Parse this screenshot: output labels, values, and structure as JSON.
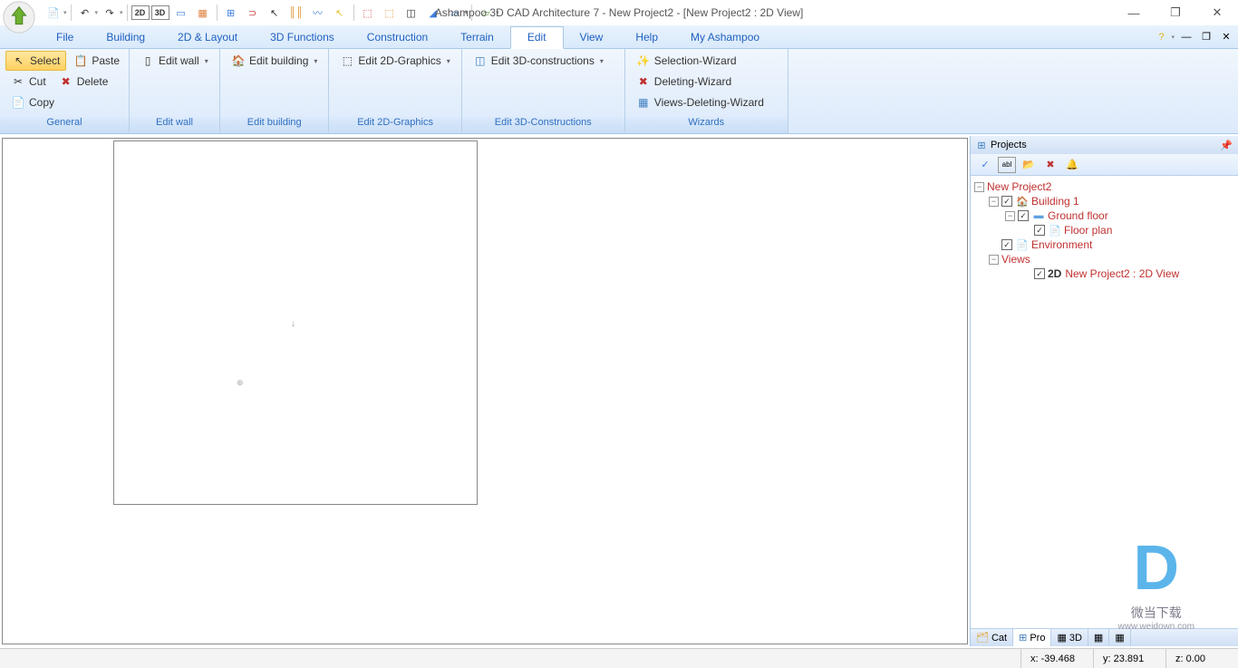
{
  "title": "Ashampoo 3D CAD Architecture 7 - New Project2 - [New Project2 : 2D View]",
  "qat": {
    "new_icon": "📄",
    "undo_icon": "↶",
    "redo_icon": "↷",
    "btn_2d": "2D",
    "btn_3d": "3D",
    "btn_row": "▭",
    "btn_grid": "▦",
    "btn_compare": "⊞",
    "btn_magnet": "🧲",
    "btn_cursor": "↖",
    "btn_lines": "║",
    "btn_wave": "〰",
    "btn_arrow2": "↖",
    "btn_tool1": "⚑",
    "btn_tool2": "⚑",
    "btn_tool3": "◫",
    "btn_eraser": "◢",
    "btn_blue": "▱",
    "btn_green": "▱"
  },
  "menu": {
    "items": [
      "File",
      "Building",
      "2D & Layout",
      "3D Functions",
      "Construction",
      "Terrain",
      "Edit",
      "View",
      "Help",
      "My Ashampoo"
    ],
    "active_index": 6,
    "help_icon": "❓"
  },
  "ribbon": {
    "groups": [
      {
        "name": "General",
        "label": "General",
        "rows": [
          [
            {
              "icon": "↖",
              "label": "Select",
              "selected": true
            },
            {
              "icon": "📋",
              "label": "Paste"
            }
          ],
          [
            {
              "icon": "✂",
              "label": "Cut"
            },
            {
              "icon": "✖",
              "label": "Delete",
              "color": "#c03030"
            }
          ],
          [
            {
              "icon": "📄",
              "label": "Copy"
            }
          ]
        ]
      },
      {
        "name": "Edit wall",
        "label": "Edit wall",
        "buttons": [
          {
            "icon": "▯",
            "label": "Edit wall",
            "dropdown": true
          }
        ]
      },
      {
        "name": "Edit building",
        "label": "Edit building",
        "buttons": [
          {
            "icon": "🏠",
            "label": "Edit building",
            "dropdown": true
          }
        ]
      },
      {
        "name": "Edit 2D-Graphics",
        "label": "Edit 2D-Graphics",
        "buttons": [
          {
            "icon": "⬚",
            "label": "Edit 2D-Graphics",
            "dropdown": true
          }
        ]
      },
      {
        "name": "Edit 3D-Constructions",
        "label": "Edit 3D-Constructions",
        "buttons": [
          {
            "icon": "◫",
            "label": "Edit 3D-constructions",
            "dropdown": true
          }
        ]
      },
      {
        "name": "Wizards",
        "label": "Wizards",
        "buttons": [
          {
            "icon": "✨",
            "label": "Selection-Wizard"
          },
          {
            "icon": "✖",
            "label": "Deleting-Wizard"
          },
          {
            "icon": "▦",
            "label": "Views-Deleting-Wizard"
          }
        ]
      }
    ]
  },
  "projects_panel": {
    "title": "Projects",
    "toolbar": [
      "✓",
      "abl",
      "📂",
      "✖",
      "🔔"
    ],
    "tree": {
      "root": "New Project2",
      "building": "Building 1",
      "floor": "Ground floor",
      "plan": "Floor plan",
      "env": "Environment",
      "views": "Views",
      "view2d_label": "2D",
      "view2d": "New Project2 : 2D View"
    },
    "tabs": [
      {
        "icon": "🗂",
        "label": "Cat"
      },
      {
        "icon": "⊞",
        "label": "Pro",
        "active": true
      },
      {
        "icon": "▦",
        "label": "3D"
      },
      {
        "icon": "▦",
        "label": ""
      },
      {
        "icon": "▦",
        "label": ""
      }
    ]
  },
  "status": {
    "x_label": "x:",
    "x": "-39.468",
    "y_label": "y:",
    "y": "23.891",
    "z_label": "z:",
    "z": "0.00"
  },
  "watermark": {
    "logo": "D",
    "text": "微当下载",
    "sub": "www.weidown.com"
  }
}
